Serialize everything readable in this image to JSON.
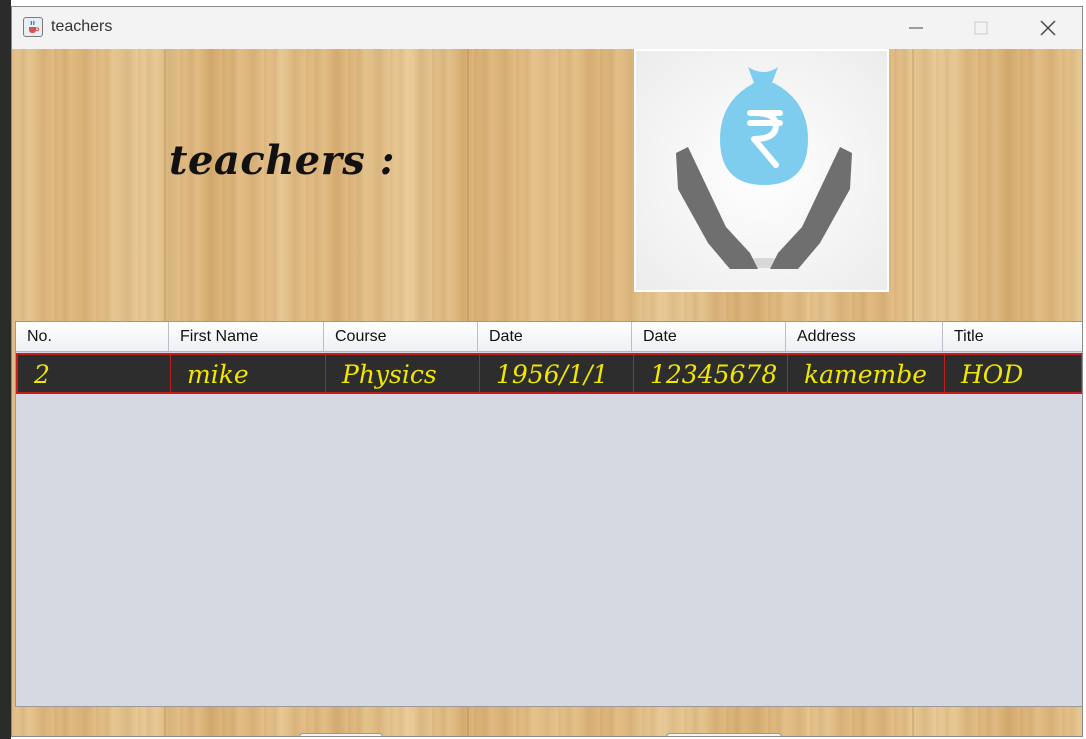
{
  "window": {
    "title": "teachers",
    "icon": "java-cup-icon",
    "controls": [
      "minimize-icon",
      "maximize-icon",
      "close-icon"
    ]
  },
  "page": {
    "heading": "teachers :",
    "logo": "money-bag-rupee-hands-icon"
  },
  "table": {
    "columns": [
      "No.",
      "First Name",
      "Course",
      "Date",
      "Date",
      "Address",
      "Title"
    ],
    "rows": [
      [
        "2",
        "mike",
        "Physics",
        "1956/1/1",
        "12345678",
        "kamembe",
        "HOD"
      ]
    ]
  },
  "colors": {
    "selected_row_bg": "#2d2d2d",
    "selected_row_text": "#f1e600",
    "selected_row_border": "#c21e1e",
    "table_bg": "#d6d9e1",
    "logo_accent": "#7fcdee"
  }
}
